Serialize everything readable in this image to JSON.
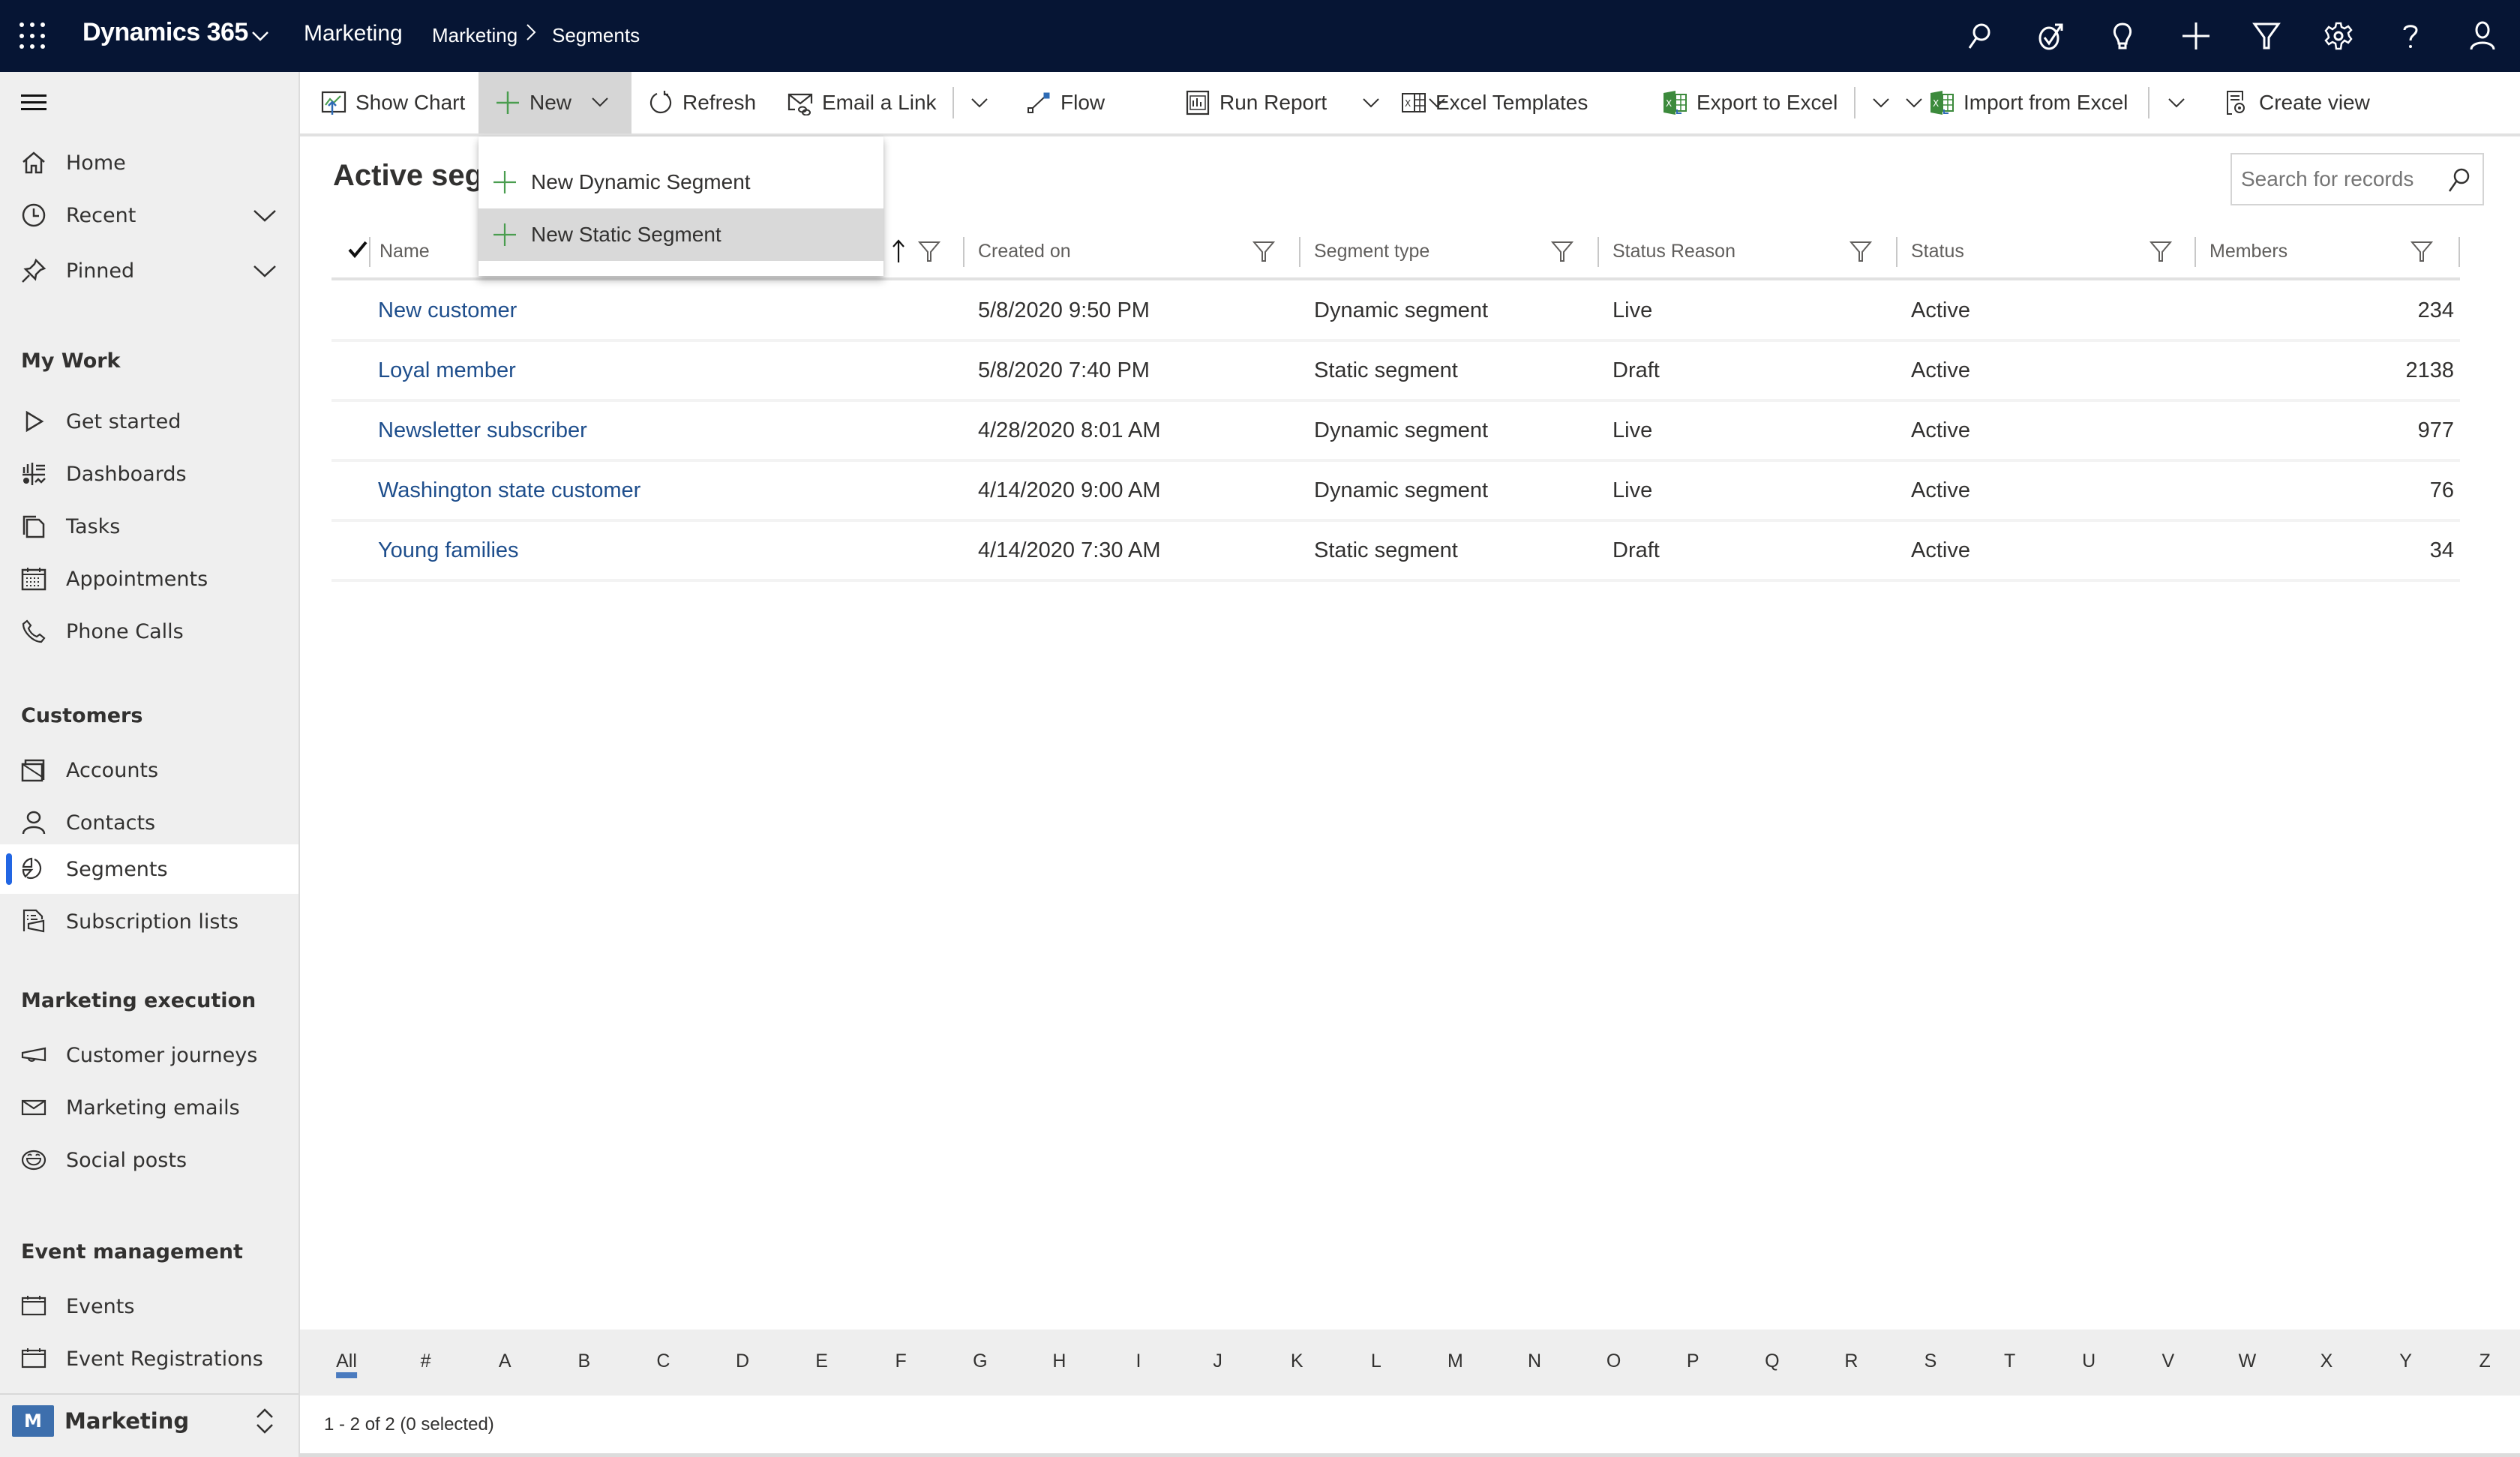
{
  "topbar": {
    "app_name": "Dynamics 365",
    "area_name": "Marketing",
    "breadcrumb": [
      "Marketing",
      "Segments"
    ],
    "icons": [
      "search-icon",
      "task-flow-icon",
      "lightbulb-icon",
      "add-icon",
      "filter-icon",
      "settings-icon",
      "help-icon",
      "user-icon"
    ]
  },
  "sidebar": {
    "top_items": [
      {
        "label": "Home",
        "icon": "home-icon"
      },
      {
        "label": "Recent",
        "icon": "clock-icon",
        "expandable": true
      },
      {
        "label": "Pinned",
        "icon": "pin-icon",
        "expandable": true
      }
    ],
    "groups": [
      {
        "title": "My Work",
        "items": [
          {
            "label": "Get started",
            "icon": "play-icon"
          },
          {
            "label": "Dashboards",
            "icon": "dashboard-icon"
          },
          {
            "label": "Tasks",
            "icon": "tasks-icon"
          },
          {
            "label": "Appointments",
            "icon": "calendar-icon"
          },
          {
            "label": "Phone Calls",
            "icon": "phone-icon"
          }
        ]
      },
      {
        "title": "Customers",
        "items": [
          {
            "label": "Accounts",
            "icon": "accounts-icon"
          },
          {
            "label": "Contacts",
            "icon": "contact-icon"
          },
          {
            "label": "Segments",
            "icon": "segments-icon",
            "active": true
          },
          {
            "label": "Subscription lists",
            "icon": "subscription-list-icon"
          }
        ]
      },
      {
        "title": "Marketing execution",
        "items": [
          {
            "label": "Customer journeys",
            "icon": "megaphone-icon"
          },
          {
            "label": "Marketing emails",
            "icon": "mail-icon"
          },
          {
            "label": "Social posts",
            "icon": "smiley-icon"
          }
        ]
      },
      {
        "title": "Event management",
        "items": [
          {
            "label": "Events",
            "icon": "event-calendar-icon"
          },
          {
            "label": "Event Registrations",
            "icon": "event-calendar-icon"
          }
        ]
      }
    ],
    "area_switcher": {
      "badge": "M",
      "label": "Marketing"
    }
  },
  "commandbar": {
    "show_chart": "Show Chart",
    "new": "New",
    "refresh": "Refresh",
    "email_link": "Email a Link",
    "flow": "Flow",
    "run_report": "Run Report",
    "excel_templates": "Excel Templates",
    "export_excel": "Export to Excel",
    "import_excel": "Import from Excel",
    "create_view": "Create view"
  },
  "new_menu": {
    "items": [
      "New Dynamic Segment",
      "New Static Segment"
    ],
    "hovered_index": 1
  },
  "view": {
    "title": "Active segments",
    "search_placeholder": "Search for records"
  },
  "grid": {
    "columns": [
      "Name",
      "Created on",
      "Segment type",
      "Status Reason",
      "Status",
      "Members"
    ],
    "sorted_column": "Name",
    "sort_direction": "ascending",
    "rows": [
      {
        "name": "New customer",
        "created_on": "5/8/2020 9:50 PM",
        "segment_type": "Dynamic segment",
        "status_reason": "Live",
        "status": "Active",
        "members": "234"
      },
      {
        "name": "Loyal member",
        "created_on": "5/8/2020 7:40 PM",
        "segment_type": "Static segment",
        "status_reason": "Draft",
        "status": "Active",
        "members": "2138"
      },
      {
        "name": "Newsletter subscriber",
        "created_on": "4/28/2020 8:01 AM",
        "segment_type": "Dynamic segment",
        "status_reason": "Live",
        "status": "Active",
        "members": "977"
      },
      {
        "name": "Washington state customer",
        "created_on": "4/14/2020 9:00 AM",
        "segment_type": "Dynamic segment",
        "status_reason": "Live",
        "status": "Active",
        "members": "76"
      },
      {
        "name": "Young families",
        "created_on": "4/14/2020 7:30 AM",
        "segment_type": "Static segment",
        "status_reason": "Draft",
        "status": "Active",
        "members": "34"
      }
    ]
  },
  "jumpbar": {
    "letters": [
      "All",
      "#",
      "A",
      "B",
      "C",
      "D",
      "E",
      "F",
      "G",
      "H",
      "I",
      "J",
      "K",
      "L",
      "M",
      "N",
      "O",
      "P",
      "Q",
      "R",
      "S",
      "T",
      "U",
      "V",
      "W",
      "X",
      "Y",
      "Z"
    ],
    "selected": "All"
  },
  "footer": {
    "status": "1 - 2 of 2 (0 selected)"
  },
  "colors": {
    "nav_bar": "#061534",
    "link": "#1e4e8c",
    "active_indicator": "#2266e3",
    "new_icon": "#4a9d4f",
    "area_badge": "#3d6fad",
    "excel_green": "#3c8a3c"
  }
}
